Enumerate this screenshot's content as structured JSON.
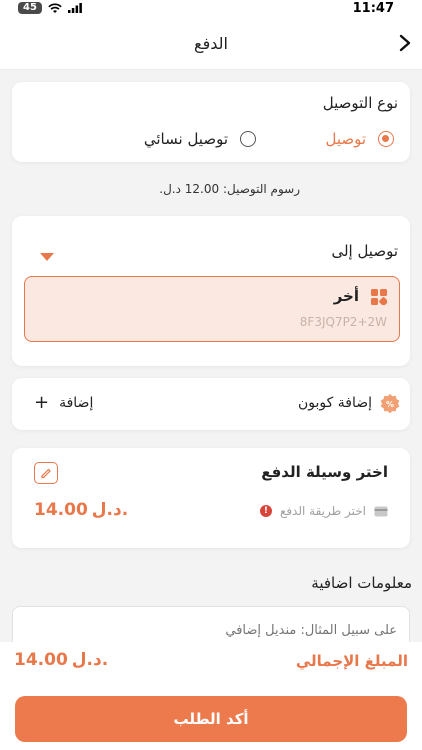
{
  "status": {
    "battery": "45",
    "time": "11:47"
  },
  "header": {
    "title": "الدفع"
  },
  "delivery_type": {
    "title": "نوع التوصيل",
    "options": [
      {
        "label": "توصيل",
        "selected": true
      },
      {
        "label": "توصيل نسائي",
        "selected": false
      }
    ]
  },
  "delivery_fee": "رسوم التوصيل: 12.00 د.ل.",
  "delivery_to": {
    "title": "توصيل إلى",
    "address_name": "أخر",
    "address_code": "8F3JQ7P2+2W"
  },
  "coupon": {
    "label": "إضافة كوبون",
    "add_label": "إضافة",
    "add_symbol": "+"
  },
  "payment": {
    "title": "اختر وسيلة الدفع",
    "method_placeholder": "اختر طريقة الدفع",
    "amount": "14.00",
    "currency": "د.ل."
  },
  "extra": {
    "title": "معلومات اضافية",
    "placeholder": "على سبيل المثال: منديل إضافي"
  },
  "total": {
    "label": "المبلغ الإجمالي",
    "amount": "14.00",
    "currency": "د.ل."
  },
  "confirm_button": "أكد الطلب",
  "colors": {
    "accent": "#e8784a",
    "accent_bg": "#fbe8e0"
  }
}
